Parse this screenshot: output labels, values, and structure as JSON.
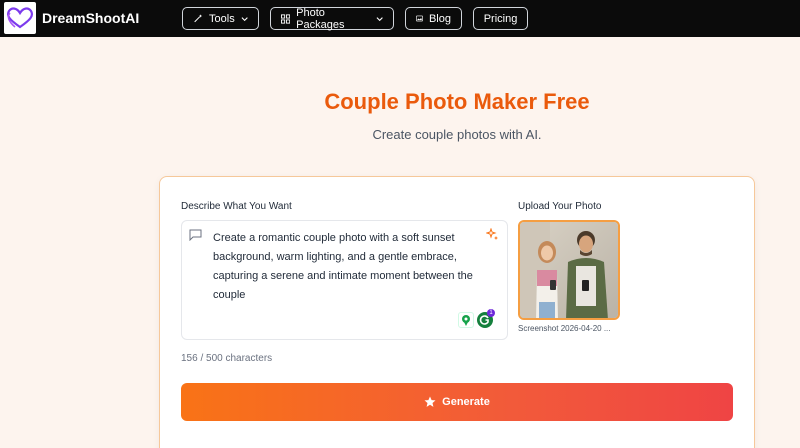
{
  "brand": {
    "name": "DreamShootAI"
  },
  "nav": {
    "tools": "Tools",
    "packages": "Photo Packages",
    "blog": "Blog",
    "pricing": "Pricing"
  },
  "hero": {
    "title": "Couple Photo Maker Free",
    "subtitle": "Create couple photos with AI."
  },
  "form": {
    "describe_label": "Describe What You Want",
    "prompt_lines": [
      "Create a romantic couple photo with a soft sunset",
      "background, warm lighting, and a gentle embrace,",
      "capturing a serene and intimate moment between the",
      "couple"
    ],
    "char_count": "156 / 500 characters",
    "upload_label": "Upload Your Photo",
    "upload_filename": "Screenshot 2026-04-20 ...",
    "generate_label": "Generate",
    "grammarly_badge": "1"
  },
  "colors": {
    "accent": "#ea5a0c",
    "nav_bg": "#0b0b0b",
    "page_bg": "#fdf4ee",
    "card_border": "#f6c89a"
  },
  "icons": {
    "logo": "heart-logo-icon",
    "tools": "magic-wand-icon",
    "packages": "grid-icon",
    "blog": "image-icon",
    "prompt": "message-square-icon",
    "enhance": "sparkles-icon",
    "generate": "star-icon"
  }
}
